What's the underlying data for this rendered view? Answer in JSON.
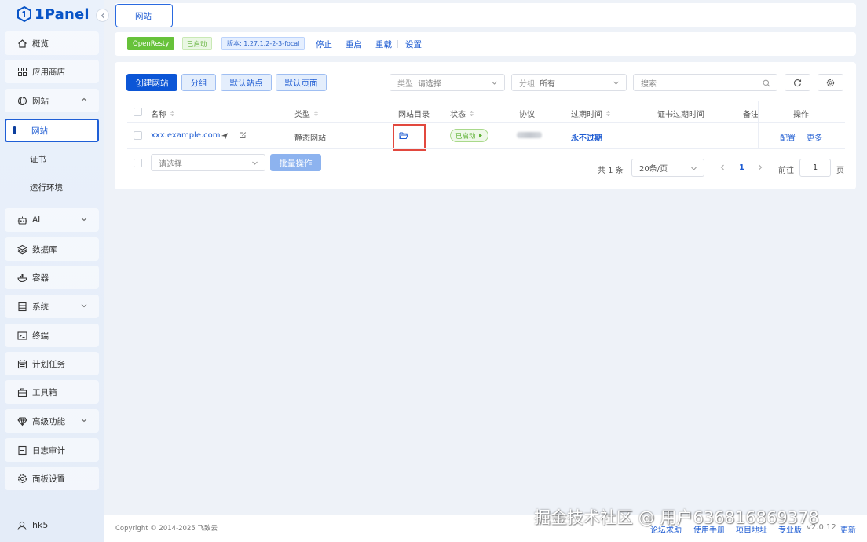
{
  "app": {
    "logo_text": "1Panel"
  },
  "sidebar": {
    "overview": "概览",
    "app_store": "应用商店",
    "website_group": "网站",
    "website": "网站",
    "certificate": "证书",
    "runtime": "运行环境",
    "ai": "AI",
    "database": "数据库",
    "container": "容器",
    "system": "系统",
    "terminal": "终端",
    "cron": "计划任务",
    "toolbox": "工具箱",
    "advanced": "高级功能",
    "log_audit": "日志审计",
    "settings": "面板设置",
    "user": "hk5"
  },
  "tabs": {
    "active": "网站"
  },
  "status": {
    "app_name": "OpenResty",
    "state": "已启动",
    "version": "版本: 1.27.1.2-2-3-focal",
    "stop": "停止",
    "restart": "重启",
    "reload": "重载",
    "settings": "设置"
  },
  "toolbar": {
    "create": "创建网站",
    "group": "分组",
    "default_site": "默认站点",
    "default_page": "默认页面",
    "type_label": "类型",
    "type_placeholder": "请选择",
    "group_label": "分组",
    "group_value": "所有",
    "search_placeholder": "搜索"
  },
  "table": {
    "headers": {
      "name": "名称",
      "type": "类型",
      "dir": "网站目录",
      "status": "状态",
      "protocol": "协议",
      "expire": "过期时间",
      "ssl_expire": "证书过期时间",
      "remark": "备注",
      "actions": "操作"
    },
    "rows": [
      {
        "name": "xxx.example.com",
        "type": "静态网站",
        "status": "已启动",
        "expire": "永不过期",
        "action_config": "配置",
        "action_more": "更多"
      }
    ]
  },
  "batch": {
    "placeholder": "请选择",
    "button": "批量操作"
  },
  "pager": {
    "total": "共 1 条",
    "page_size": "20条/页",
    "current": "1",
    "goto_label": "前往",
    "goto_value": "1",
    "page_unit": "页"
  },
  "footer": {
    "copyright": "Copyright © 2014-2025 飞致云",
    "forum": "论坛求助",
    "manual": "使用手册",
    "project": "项目地址",
    "pro": "专业版",
    "version": "v2.0.12",
    "update": "更新"
  },
  "watermark": "掘金技术社区 @ 用户636816869378",
  "colors": {
    "primary": "#0c56d6",
    "success": "#67c23a",
    "highlight": "#e2483e"
  }
}
